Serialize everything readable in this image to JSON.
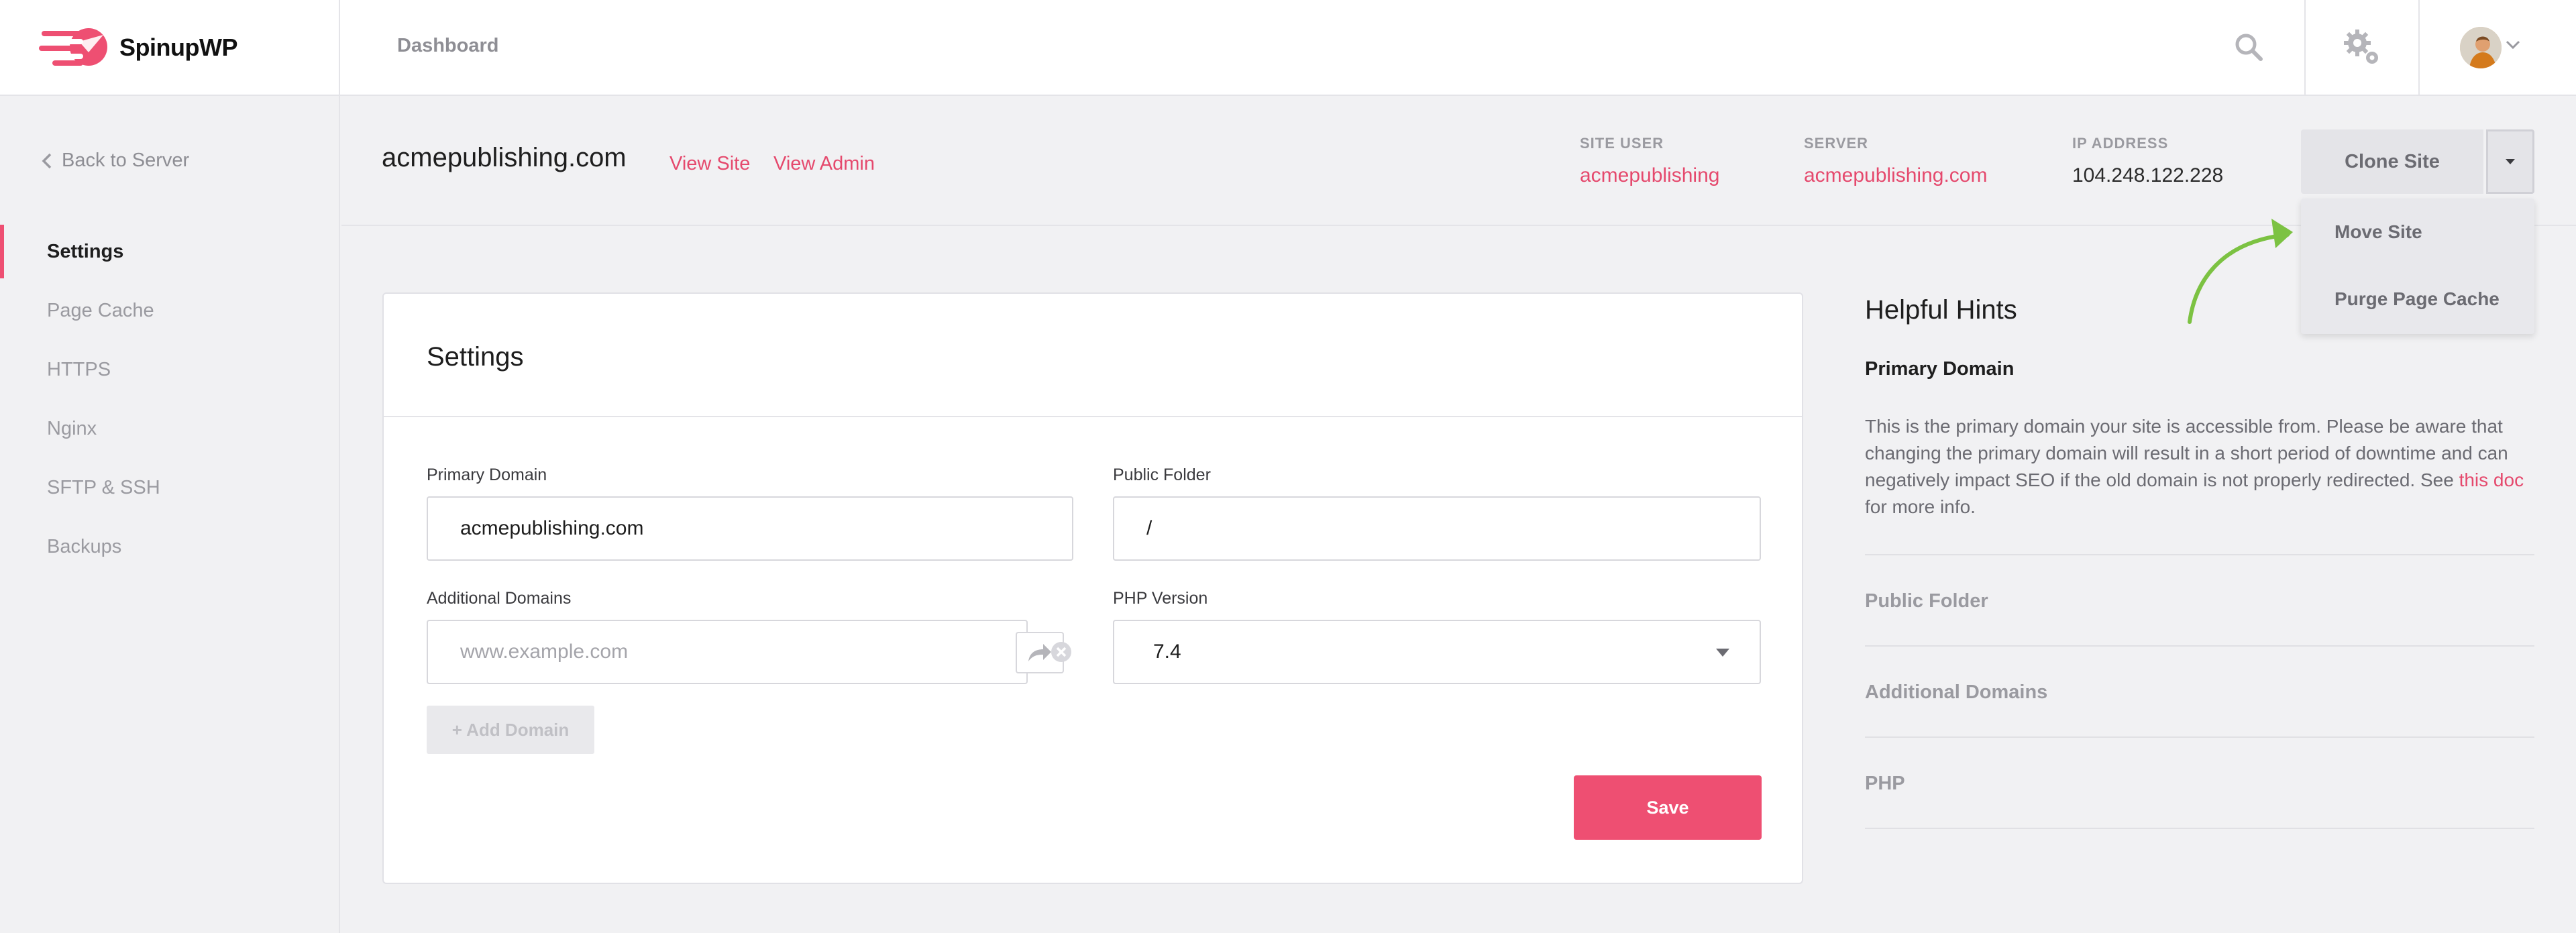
{
  "brand": {
    "name": "SpinupWP",
    "logo_icon": "spinupwp-logo",
    "color": "#ee4f72"
  },
  "topnav": {
    "dashboard": "Dashboard",
    "search_icon": "search-icon",
    "settings_icon": "gear-icon",
    "avatar_icon": "user-avatar"
  },
  "sidebar": {
    "back_label": "Back to Server",
    "items": [
      {
        "label": "Settings",
        "active": true
      },
      {
        "label": "Page Cache"
      },
      {
        "label": "HTTPS"
      },
      {
        "label": "Nginx"
      },
      {
        "label": "SFTP & SSH"
      },
      {
        "label": "Backups"
      }
    ]
  },
  "site": {
    "name": "acmepublishing.com",
    "view_site": "View Site",
    "view_admin": "View Admin",
    "meta": {
      "site_user_label": "SITE USER",
      "site_user": "acmepublishing",
      "server_label": "SERVER",
      "server": "acmepublishing.com",
      "ip_label": "IP ADDRESS",
      "ip": "104.248.122.228"
    },
    "actions": {
      "clone_label": "Clone Site",
      "menu_items": [
        "Move Site",
        "Purge Page Cache"
      ]
    }
  },
  "settings": {
    "title": "Settings",
    "primary_domain_label": "Primary Domain",
    "primary_domain_value": "acmepublishing.com",
    "public_folder_label": "Public Folder",
    "public_folder_value": "/",
    "additional_domains_label": "Additional Domains",
    "additional_domains_placeholder": "www.example.com",
    "php_version_label": "PHP Version",
    "php_version_value": "7.4",
    "add_domain_label": "+ Add Domain",
    "save_label": "Save"
  },
  "hints": {
    "title": "Helpful Hints",
    "primary_title": "Primary Domain",
    "primary_body_pre": "This is the primary domain your site is accessible from. Please be aware that changing the primary domain will result in a short period of downtime and can negatively impact SEO if the old domain is not properly redirected. See ",
    "primary_body_link": "this doc",
    "primary_body_post": " for more info.",
    "sections": [
      "Public Folder",
      "Additional Domains",
      "PHP"
    ]
  },
  "colors": {
    "accent": "#ee4f72",
    "link": "#e5496d",
    "hint_arrow": "#7cc242"
  }
}
